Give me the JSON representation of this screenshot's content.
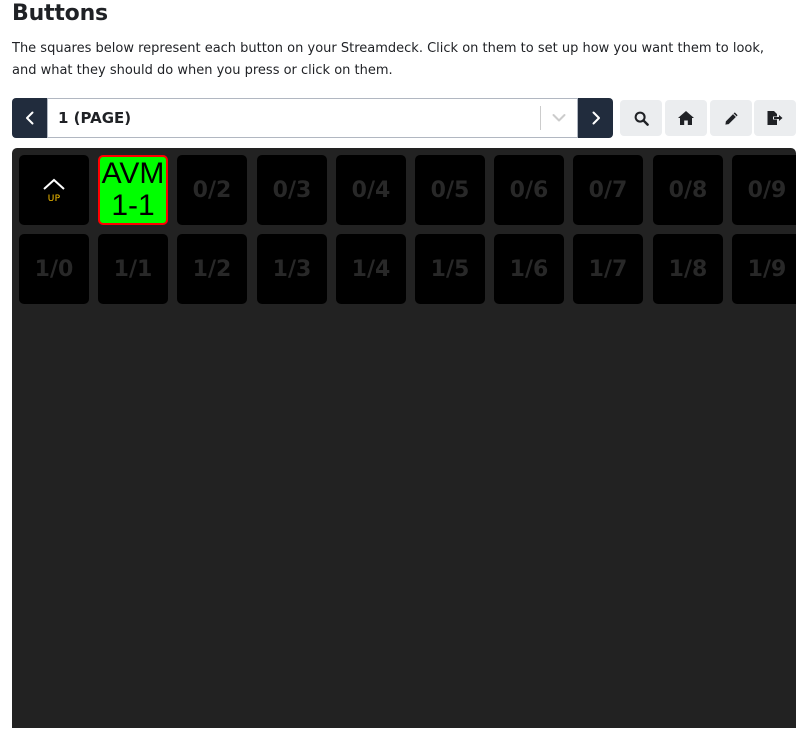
{
  "header": {
    "title": "Buttons",
    "description": "The squares below represent each button on your Streamdeck. Click on them to set up how you want them to look, and what they should do when you press or click on them."
  },
  "toolbar": {
    "prev_icon": "chevron-left-icon",
    "next_icon": "chevron-right-icon",
    "page_select_value": "1 (PAGE)",
    "dropdown_icon": "chevron-down-icon",
    "tools": [
      "search-icon",
      "home-icon",
      "pencil-icon",
      "export-icon"
    ]
  },
  "grid": {
    "up_key": {
      "icon": "chevron-up-icon",
      "label": "UP",
      "label_color": "#ffc600"
    },
    "avm_key": {
      "line1": "AVM",
      "line2": "1-1",
      "bg_color": "#00ff00",
      "border_color": "#ff0000"
    },
    "row0": [
      "0/2",
      "0/3",
      "0/4",
      "0/5",
      "0/6",
      "0/7",
      "0/8",
      "0/9"
    ],
    "row1": [
      "1/0",
      "1/1",
      "1/2",
      "1/3",
      "1/4",
      "1/5",
      "1/6",
      "1/7",
      "1/8",
      "1/9"
    ]
  },
  "colors": {
    "nav_bg": "#212c3d",
    "grid_bg": "#222222",
    "key_bg": "#000000",
    "tool_bg": "#ebedef"
  }
}
